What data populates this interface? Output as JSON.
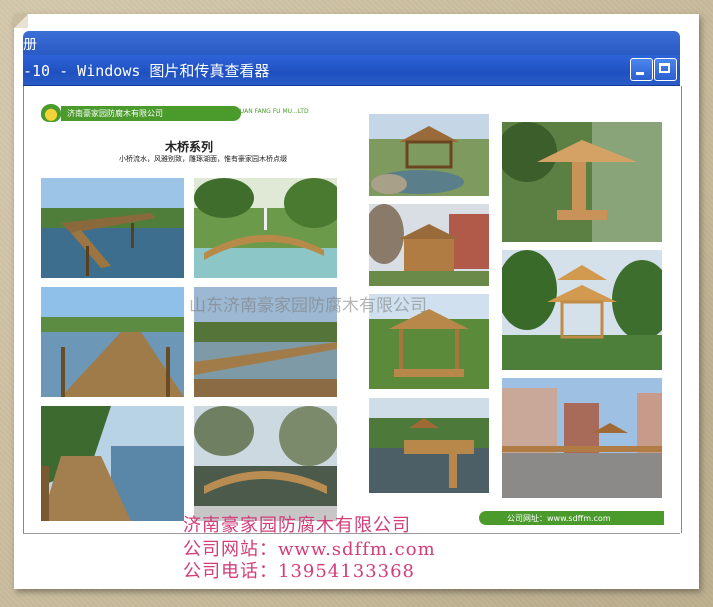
{
  "window": {
    "top_fragment": "册",
    "title": "-10 - Windows 图片和传真查看器",
    "minimize_label": "",
    "maximize_label": ""
  },
  "brochure": {
    "company_bar": "济南豪家园防腐木有限公司",
    "company_pinyin": "JI NAN HAO JIA YUAN FANG FU MU...LTD",
    "series_title": "木桥系列",
    "series_subtitle": "小桥流水，风雅别致，雕琢湖面，惟有豪家园木桥点缀",
    "footer_url": "公司网址：www.sdffm.com",
    "watermark": "山东济南豪家园防腐木有限公司"
  },
  "contact": {
    "company": "济南豪家园防腐木有限公司",
    "website": "公司网站：www.sdffm.com",
    "phone": "公司电话：13954133368"
  },
  "colors": {
    "titlebar": "#2e63d8",
    "brand_green": "#4a9a2c",
    "contact_text": "#d23d7a",
    "background": "#c9bc9e"
  }
}
